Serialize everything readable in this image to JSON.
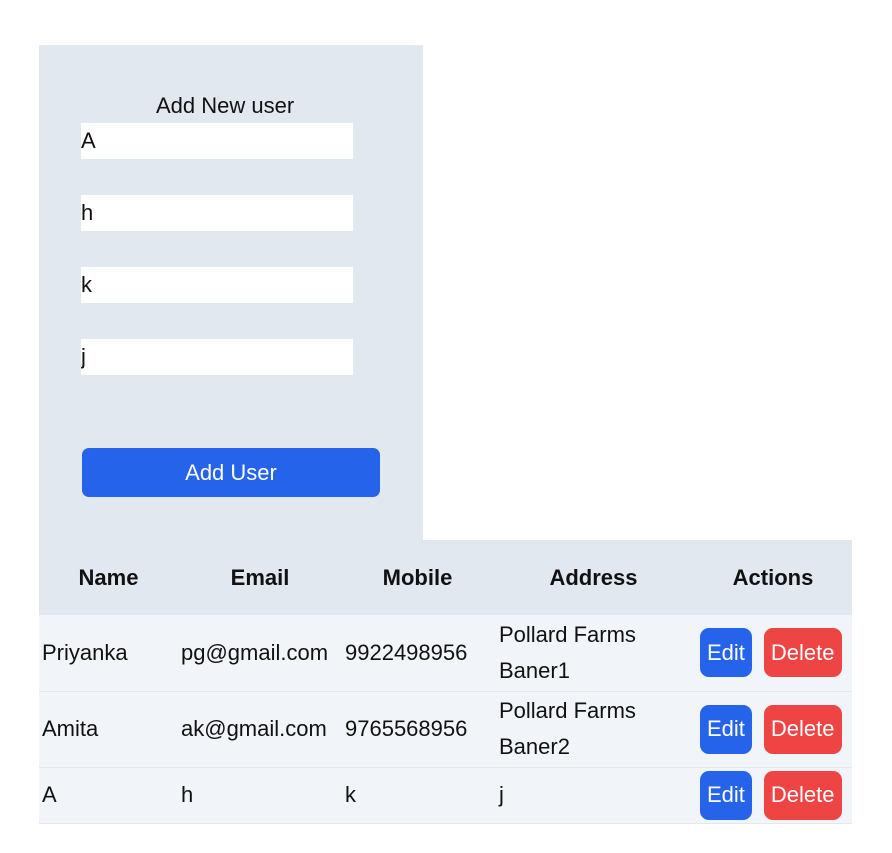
{
  "form": {
    "title": "Add New user",
    "fields": [
      {
        "value": "A"
      },
      {
        "value": "h"
      },
      {
        "value": "k"
      },
      {
        "value": "j"
      }
    ],
    "submit_label": "Add User"
  },
  "table": {
    "headers": [
      "Name",
      "Email",
      "Mobile",
      "Address",
      "Actions"
    ],
    "rows": [
      {
        "name": "Priyanka",
        "email": "pg@gmail.com",
        "mobile": "9922498956",
        "address": "Pollard Farms Baner1"
      },
      {
        "name": "Amita",
        "email": "ak@gmail.com",
        "mobile": "9765568956",
        "address": "Pollard Farms Baner2"
      },
      {
        "name": "A",
        "email": "h",
        "mobile": "k",
        "address": "j"
      }
    ],
    "edit_label": "Edit",
    "delete_label": "Delete"
  },
  "colors": {
    "panel": "#e2e8f0",
    "primary": "#2563eb",
    "danger": "#ef4444",
    "row": "#f1f5f9"
  }
}
